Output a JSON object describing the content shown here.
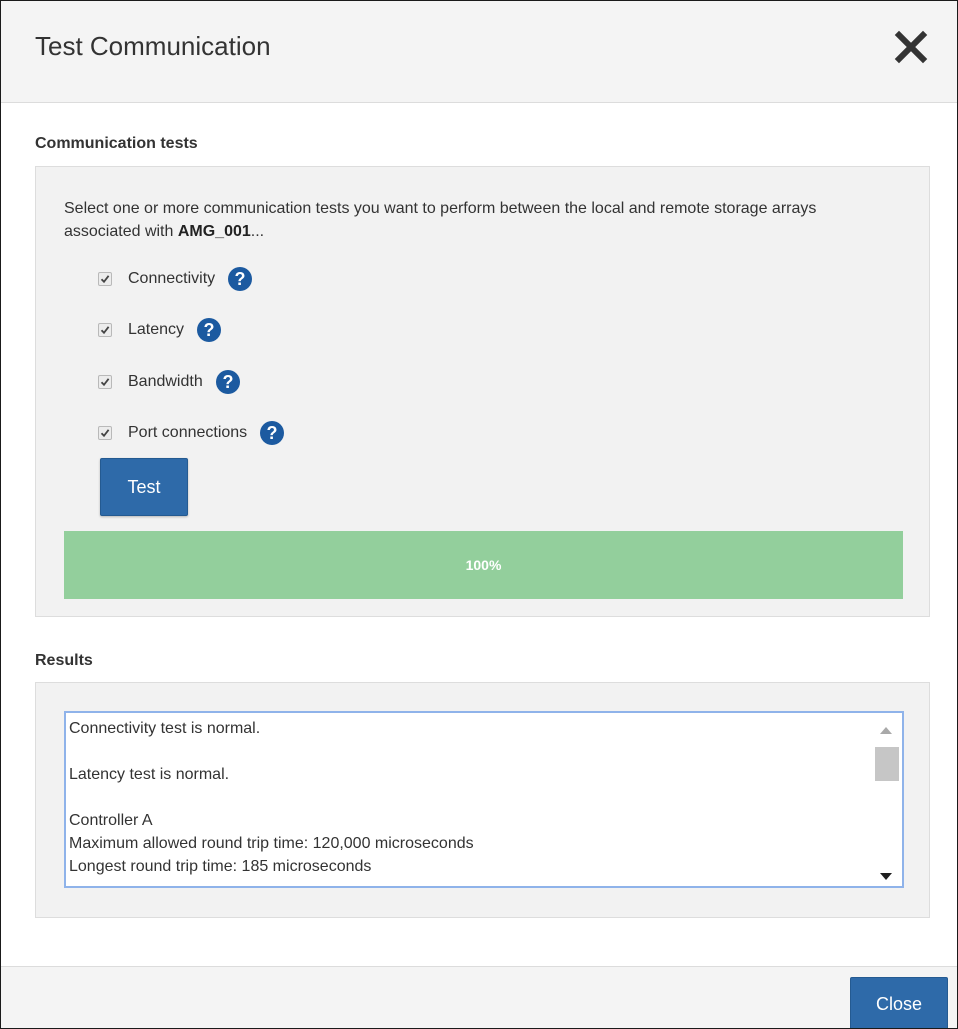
{
  "dialog": {
    "title": "Test Communication",
    "close_icon": "close-icon"
  },
  "communication_tests": {
    "section_title": "Communication tests",
    "description_prefix": "Select one or more communication tests you want to perform between the local and remote storage arrays associated with ",
    "group_name": "AMG_001",
    "description_suffix": "...",
    "tests": [
      {
        "label": "Connectivity",
        "checked": true,
        "help_icon": "question-circle-icon"
      },
      {
        "label": "Latency",
        "checked": true,
        "help_icon": "question-circle-icon"
      },
      {
        "label": "Bandwidth",
        "checked": true,
        "help_icon": "question-circle-icon"
      },
      {
        "label": "Port connections",
        "checked": true,
        "help_icon": "question-circle-icon"
      }
    ],
    "test_button_label": "Test",
    "progress": {
      "value": 100,
      "label": "100%",
      "fill_color": "#93cf9c"
    }
  },
  "results": {
    "section_title": "Results",
    "lines": [
      "Connectivity test is normal.",
      "",
      "Latency test is normal.",
      "",
      "Controller A",
      "Maximum allowed round trip time: 120,000 microseconds",
      "Longest round trip time: 185 microseconds"
    ]
  },
  "footer": {
    "close_button_label": "Close"
  },
  "colors": {
    "primary_button": "#2e6aa9",
    "help_icon": "#1c5aa0",
    "progress_fill": "#93cf9c"
  }
}
